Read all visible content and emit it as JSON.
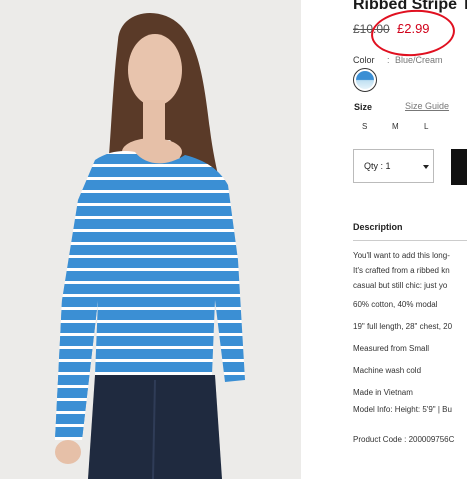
{
  "product": {
    "title": "Ribbed Stripe To",
    "old_price": "£10.00",
    "new_price": "£2.99",
    "color_label": "Color",
    "color_separator": ":",
    "color_value": "Blue/Cream",
    "size_label": "Size",
    "size_guide": "Size Guide",
    "sizes": [
      "S",
      "M",
      "L"
    ],
    "qty_label": "Qty : 1"
  },
  "description": {
    "heading": "Description",
    "lines": [
      "You'll want to add this long-",
      "It's crafted from a ribbed kn",
      "casual but still chic: just yo",
      "60% cotton, 40% modal",
      "19\" full length, 28\" chest, 20",
      "Measured from Small",
      "Machine wash cold",
      "Made in Vietnam",
      "Model Info: Height: 5'9\" | Bu",
      "Product Code : 200009756C"
    ]
  },
  "colors": {
    "sale_red": "#d0021b",
    "annotation_circle": "#e01020",
    "stripe_blue": "#3b8fd4"
  }
}
